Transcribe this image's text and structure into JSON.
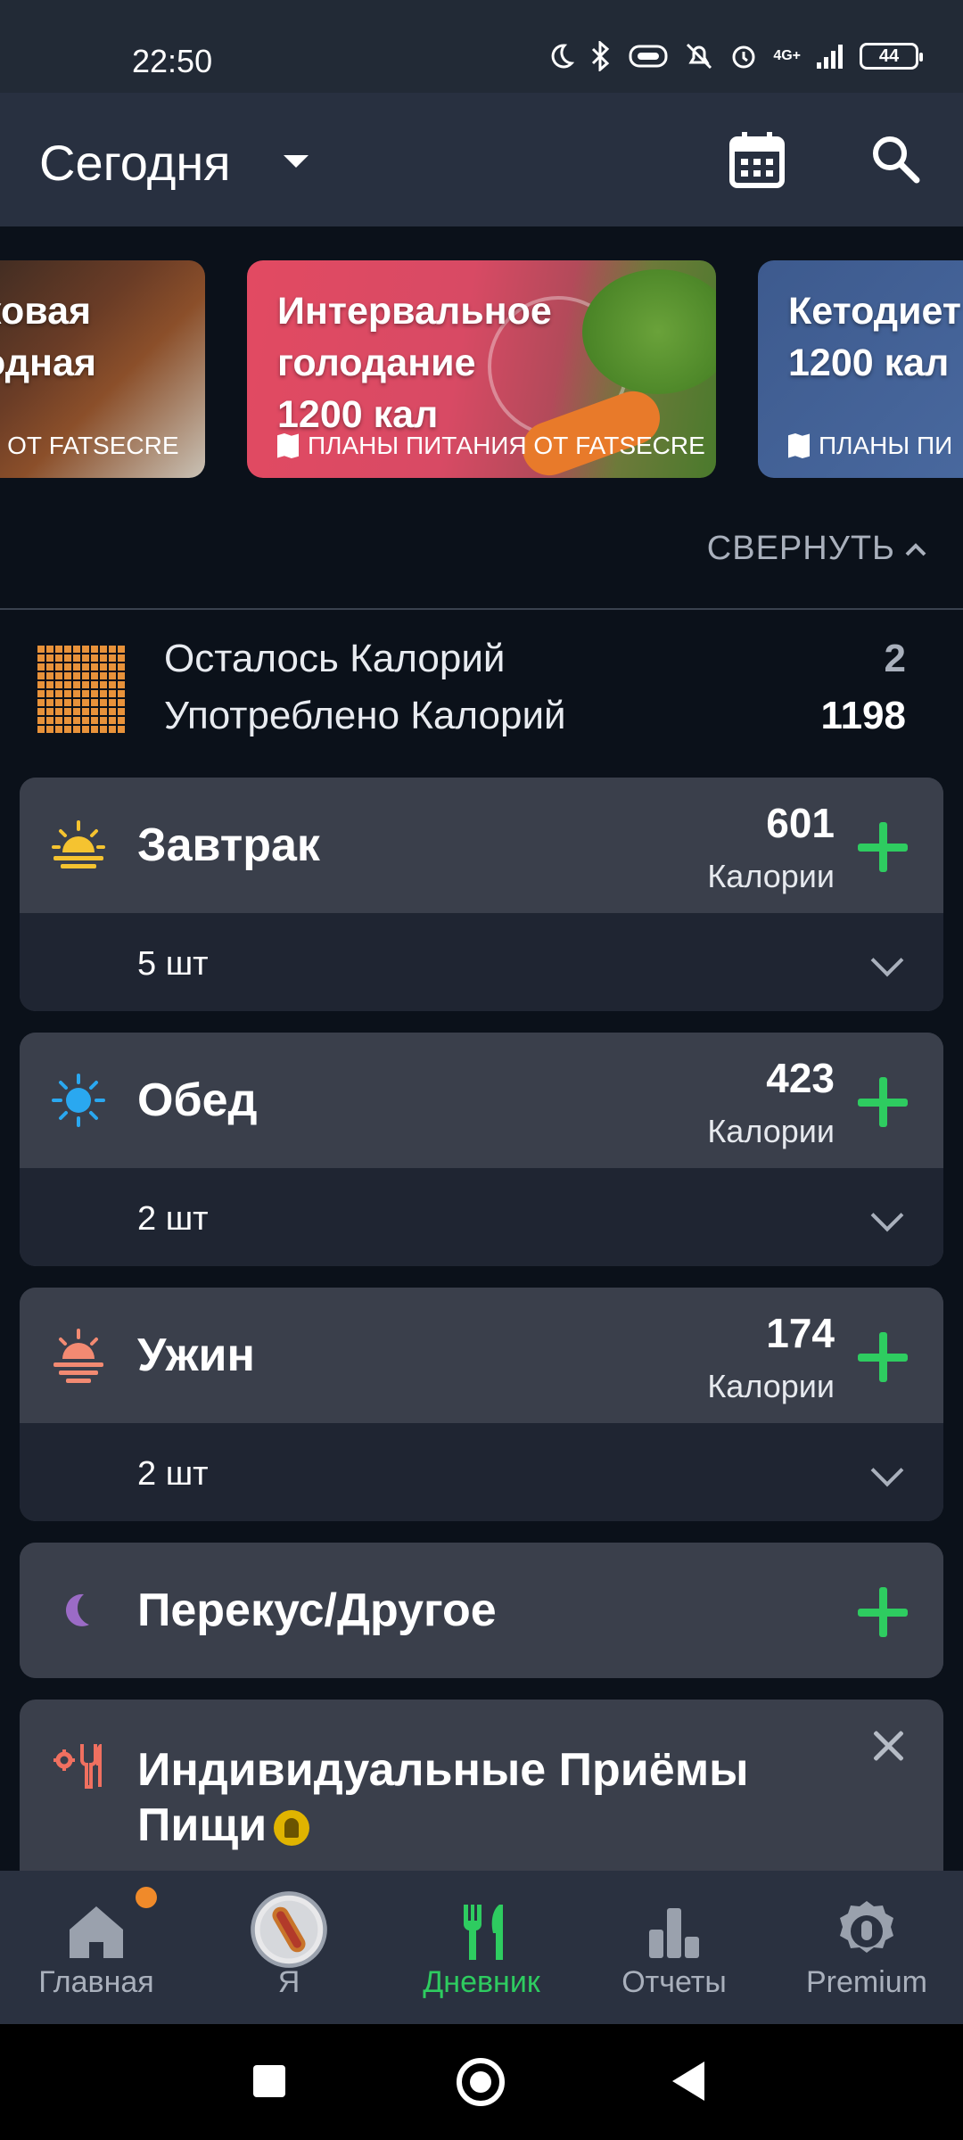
{
  "status_bar": {
    "time": "22:50",
    "network": "4G+",
    "battery": "44",
    "icons": [
      "moon-icon",
      "bluetooth-icon",
      "vibrate-icon",
      "mute-icon",
      "alarm-icon",
      "signal-icon",
      "battery-icon"
    ]
  },
  "app_bar": {
    "title": "Сегодня",
    "icons": [
      "calendar-icon",
      "search-icon"
    ]
  },
  "meal_plans": [
    {
      "title": "ковая\nодная",
      "subtitle": "ИЯ ОТ FATSECRE"
    },
    {
      "title": "Интервальное\nголодание\n1200 кал",
      "subtitle": "ПЛАНЫ ПИТАНИЯ ОТ FATSECRE"
    },
    {
      "title": "Кетодиет\n1200 кал",
      "subtitle": "ПЛАНЫ ПИ"
    }
  ],
  "collapse_label": "СВЕРНУТЬ",
  "summary": {
    "remaining_label": "Осталось Калорий",
    "remaining_value": "2",
    "consumed_label": "Употреблено Калорий",
    "consumed_value": "1198"
  },
  "meals": [
    {
      "name": "Завтрак",
      "calories": "601",
      "calories_label": "Калории",
      "count": "5 шт",
      "icon": "sunrise-icon"
    },
    {
      "name": "Обед",
      "calories": "423",
      "calories_label": "Калории",
      "count": "2 шт",
      "icon": "sun-icon"
    },
    {
      "name": "Ужин",
      "calories": "174",
      "calories_label": "Калории",
      "count": "2 шт",
      "icon": "sunset-icon"
    }
  ],
  "snack": {
    "name": "Перекус/Другое",
    "icon": "moon-icon"
  },
  "custom_meals": {
    "title": "Индивидуальные Приёмы Пищи",
    "icon": "utensils-gear-icon"
  },
  "bottom_nav": [
    {
      "label": "Главная",
      "icon": "home-icon",
      "active": false
    },
    {
      "label": "Я",
      "icon": "avatar",
      "active": false
    },
    {
      "label": "Дневник",
      "icon": "fork-knife-icon",
      "active": true
    },
    {
      "label": "Отчеты",
      "icon": "bar-chart-icon",
      "active": false
    },
    {
      "label": "Premium",
      "icon": "premium-lock-icon",
      "active": false
    }
  ],
  "colors": {
    "accent_green": "#2ecc60",
    "summary_orange": "#e8923a",
    "background": "#0b111a",
    "card": "#3a3f4b"
  }
}
